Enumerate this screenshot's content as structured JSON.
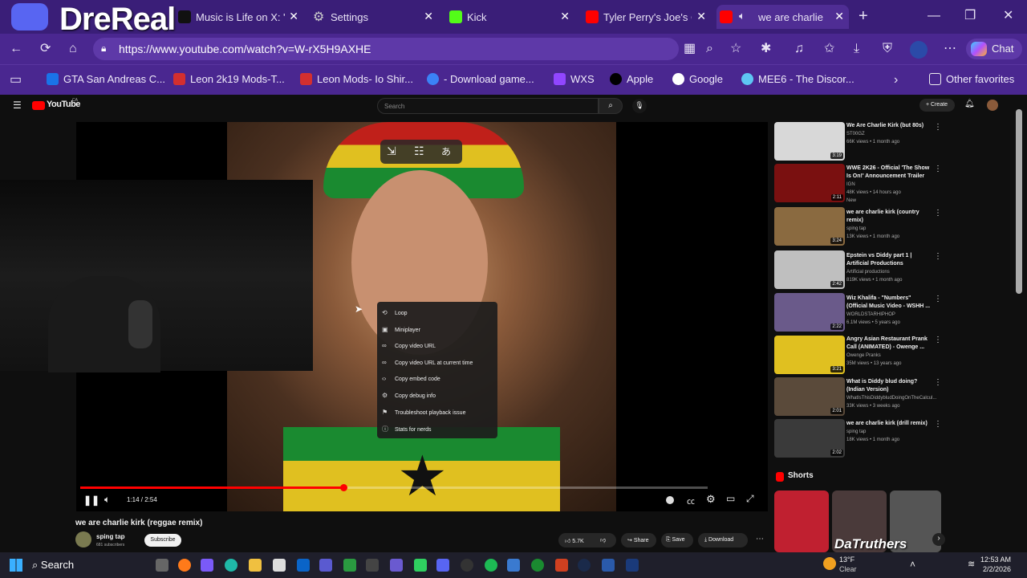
{
  "overlay": {
    "streamer_name": "DreReal"
  },
  "tabs": [
    {
      "label": "Music is Life on X: \"",
      "color": "#555"
    },
    {
      "label": "Settings",
      "color": "#777"
    },
    {
      "label": "Kick",
      "color": "#53fc18"
    },
    {
      "label": "Tyler Perry's Joe's Co",
      "color": "#ff0000"
    },
    {
      "label": "we are charlie k",
      "color": "#ff0000"
    }
  ],
  "address": {
    "url": "https://www.youtube.com/watch?v=W-rX5H9AXHE"
  },
  "toolbar": {
    "chat_label": "Chat"
  },
  "favorites": [
    {
      "label": "GTA San Andreas C...",
      "color": "#1a73e8"
    },
    {
      "label": "Leon 2k19 Mods-T...",
      "color": "#d32f2f"
    },
    {
      "label": "Leon Mods- Io Shir...",
      "color": "#d32f2f"
    },
    {
      "label": "- Download game...",
      "color": "#3b82f6"
    },
    {
      "label": "WXS",
      "color": "#9146ff"
    },
    {
      "label": "Apple",
      "color": "#000000"
    },
    {
      "label": "Google",
      "color": "#ffffff"
    },
    {
      "label": "MEE6 - The Discor...",
      "color": "#5ec6f3"
    }
  ],
  "favorites_other": "Other favorites",
  "youtube": {
    "logo": "YouTube",
    "logo_country": "CA",
    "search_placeholder": "Search",
    "create_label": "Create"
  },
  "player": {
    "time": "1:14 / 2:54",
    "progress": 0.42
  },
  "context_menu": [
    {
      "icon": "loop-icon",
      "glyph": "⟲",
      "label": "Loop"
    },
    {
      "icon": "miniplayer-icon",
      "glyph": "▣",
      "label": "Miniplayer"
    },
    {
      "icon": "link-icon",
      "glyph": "∞",
      "label": "Copy video URL"
    },
    {
      "icon": "link-icon",
      "glyph": "∞",
      "label": "Copy video URL at current time"
    },
    {
      "icon": "code-icon",
      "glyph": "‹›",
      "label": "Copy embed code"
    },
    {
      "icon": "debug-icon",
      "glyph": "⚙",
      "label": "Copy debug info"
    },
    {
      "icon": "flag-icon",
      "glyph": "⚑",
      "label": "Troubleshoot playback issue"
    },
    {
      "icon": "info-icon",
      "glyph": "ⓘ",
      "label": "Stats for nerds"
    }
  ],
  "video": {
    "title": "we are charlie kirk (reggae remix)",
    "channel": "sping tap",
    "subscribers": "681 subscribers",
    "subscribe_label": "Subscribe",
    "likes": "5.7K",
    "share_label": "Share",
    "save_label": "Save",
    "download_label": "Download"
  },
  "sidebar": [
    {
      "title": "We Are Charlie Kirk (but 80s)",
      "channel": "ST00GZ",
      "meta": "66K views • 1 month ago",
      "duration": "3:19",
      "thumb": "#d8d8d8"
    },
    {
      "title": "WWE 2K26 - Official 'The Show Is On!' Announcement Trailer",
      "channel": "IGN",
      "meta": "48K views • 14 hours ago",
      "badge": "New",
      "duration": "2:11",
      "thumb": "#7a1010"
    },
    {
      "title": "we are charlie kirk (country remix)",
      "channel": "sping tap",
      "meta": "13K views • 1 month ago",
      "duration": "3:24",
      "thumb": "#8a6a40"
    },
    {
      "title": "Epstein vs Diddy part 1 | Artificial Productions",
      "channel": "Artificial productions",
      "meta": "819K views • 1 month ago",
      "duration": "2:42",
      "thumb": "#bfbfbf"
    },
    {
      "title": "Wiz Khalifa - \"Numbers\" (Official Music Video - WSHH ...",
      "channel": "WORLDSTARHIPHOP",
      "meta": "6.1M views • 5 years ago",
      "duration": "2:22",
      "thumb": "#6a5a8a"
    },
    {
      "title": "Angry Asian Restaurant Prank Call (ANIMATED) - Owenge ...",
      "channel": "Owenge Pranks",
      "meta": "35M views • 13 years ago",
      "duration": "3:21",
      "thumb": "#e0c020"
    },
    {
      "title": "What is Diddy blud doing? (Indian Version)",
      "channel": "WhatIsThisDiddybludDoingOnTheCalcul...",
      "meta": "33K views • 3 weeks ago",
      "duration": "2:01",
      "thumb": "#5a4a3a"
    },
    {
      "title": "we are charlie kirk (drill remix)",
      "channel": "sping tap",
      "meta": "18K views • 1 month ago",
      "duration": "2:02",
      "thumb": "#3a3a3a"
    }
  ],
  "shorts": {
    "label": "Shorts",
    "overlay_text": "DaTruthers"
  },
  "taskbar": {
    "search_label": "Search",
    "weather_temp": "13°F",
    "weather_desc": "Clear",
    "time": "12:53 AM",
    "date": "2/2/2026"
  }
}
